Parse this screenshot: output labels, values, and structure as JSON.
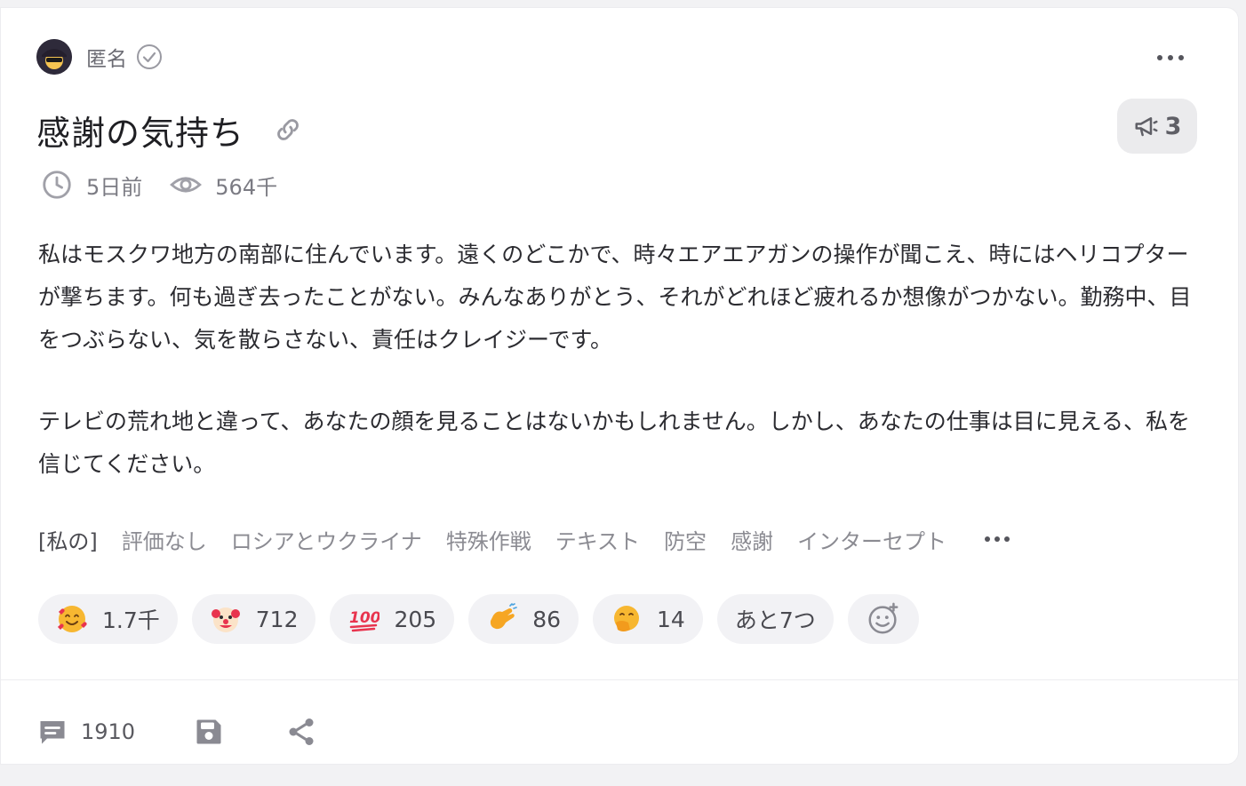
{
  "post": {
    "author": "匿名",
    "title": "感謝の気持ち",
    "promo_count": "3",
    "time_ago": "5日前",
    "views": "564千",
    "paragraphs": [
      "私はモスクワ地方の南部に住んでいます。遠くのどこかで、時々エアエアガンの操作が聞こえ、時にはヘリコプターが撃ちます。何も過ぎ去ったことがない。みんなありがとう、それがどれほど疲れるか想像がつかない。勤務中、目をつぶらない、気を散らさない、責任はクレイジーです。",
      "テレビの荒れ地と違って、あなたの顔を見ることはないかもしれません。しかし、あなたの仕事は目に見える、私を信じてください。"
    ],
    "tags": [
      "[私の]",
      "評価なし",
      "ロシアとウクライナ",
      "特殊作戦",
      "テキスト",
      "防空",
      "感謝",
      "インターセプト"
    ],
    "reactions": [
      {
        "icon": "smiling-face-with-hearts-emoji",
        "count": "1.7千"
      },
      {
        "icon": "clown-face-emoji",
        "count": "712"
      },
      {
        "icon": "hundred-points-emoji",
        "count": "205"
      },
      {
        "icon": "clapping-hands-emoji",
        "count": "86"
      },
      {
        "icon": "face-with-hand-over-mouth-emoji",
        "count": "14"
      }
    ],
    "more_reactions": "あと7つ",
    "comments_count": "1910"
  },
  "icons": {
    "avatar": "anonymous-avatar-icon",
    "verified": "check-circle-icon",
    "more": "ellipsis-icon",
    "link": "link-icon",
    "promo": "megaphone-icon",
    "time": "clock-icon",
    "views": "eye-icon",
    "add_reaction": "add-emoji-icon",
    "comments": "comment-icon",
    "save": "save-icon",
    "share": "share-icon"
  },
  "colors": {
    "accent_text": "#2a2a2e",
    "muted": "#7b7b83",
    "chip_bg": "#f2f2f5",
    "emoji_yellow": "#f6a623",
    "emoji_red": "#e8344e"
  }
}
